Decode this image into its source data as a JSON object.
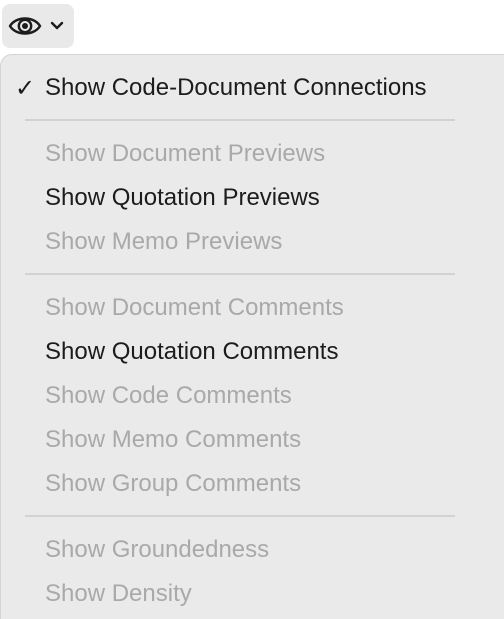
{
  "toolbar": {
    "view_button_icon": "eye-icon",
    "view_button_chevron": "chevron-down-icon"
  },
  "menu": {
    "checkmark": "✓",
    "items": [
      {
        "label": "Show Code-Document Connections",
        "enabled": true,
        "checked": true
      },
      {
        "label": "Show Document Previews",
        "enabled": false,
        "checked": false
      },
      {
        "label": "Show Quotation Previews",
        "enabled": true,
        "checked": false
      },
      {
        "label": "Show Memo Previews",
        "enabled": false,
        "checked": false
      },
      {
        "label": "Show Document Comments",
        "enabled": false,
        "checked": false
      },
      {
        "label": "Show Quotation Comments",
        "enabled": true,
        "checked": false
      },
      {
        "label": "Show Code Comments",
        "enabled": false,
        "checked": false
      },
      {
        "label": "Show Memo Comments",
        "enabled": false,
        "checked": false
      },
      {
        "label": "Show Group Comments",
        "enabled": false,
        "checked": false
      },
      {
        "label": "Show Groundedness",
        "enabled": false,
        "checked": false
      },
      {
        "label": "Show Density",
        "enabled": false,
        "checked": false
      }
    ]
  },
  "colors": {
    "menu_background": "#eaeaea",
    "enabled_text": "#1c1c1c",
    "disabled_text": "#a9a9a9",
    "separator": "#d2d2d2"
  }
}
